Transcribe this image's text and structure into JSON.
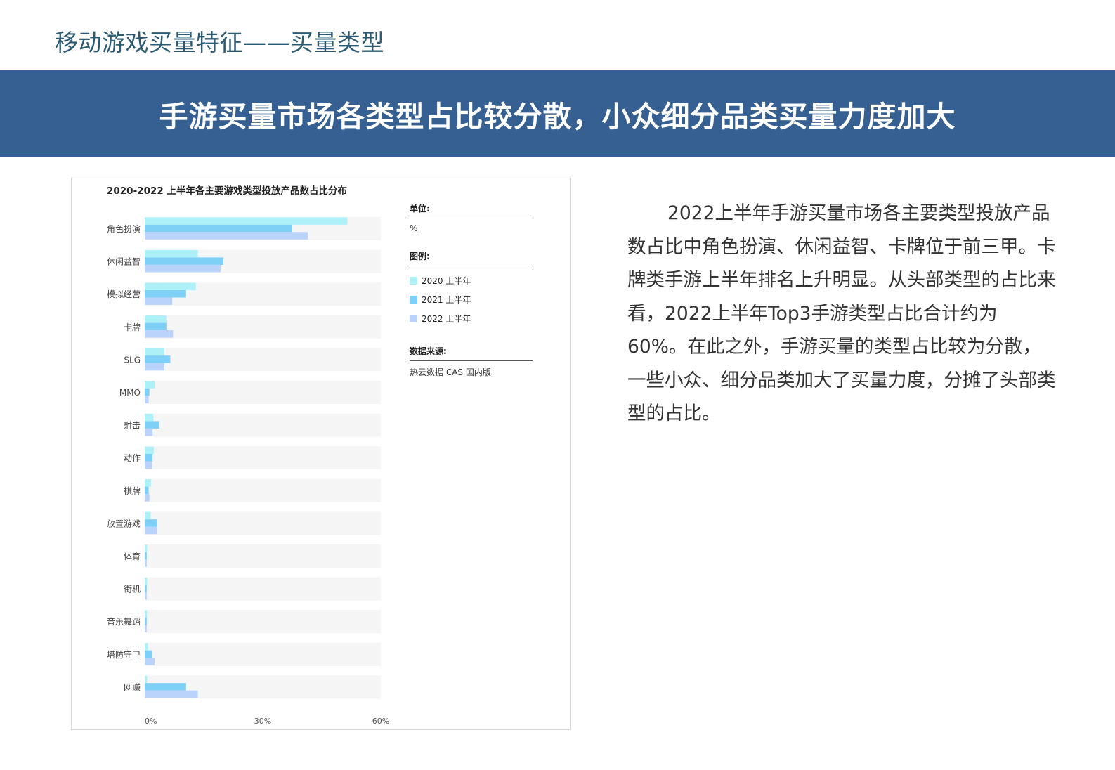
{
  "page": {
    "section_title": "移动游戏买量特征——买量类型",
    "headline": "手游买量市场各类型占比较分散，小众细分品类买量力度加大",
    "body": "2022上半年手游买量市场各主要类型投放产品数占比中角色扮演、休闲益智、卡牌位于前三甲。卡牌类手游上半年排名上升明显。从头部类型的占比来看，2022上半年Top3手游类型占比合计约为60%。在此之外，手游买量的类型占比较为分散，一些小众、细分品类加大了买量力度，分摊了头部类型的占比。"
  },
  "legend_panel": {
    "unit_heading": "单位:",
    "unit_value": "%",
    "legend_heading": "图例:",
    "source_heading": "数据来源:",
    "source_value": "热云数据 CAS 国内版"
  },
  "chart_data": {
    "type": "bar",
    "orientation": "horizontal",
    "title": "2020-2022 上半年各主要游戏类型投放产品数占比分布",
    "categories": [
      "角色扮演",
      "休闲益智",
      "模拟经营",
      "卡牌",
      "SLG",
      "MMO",
      "射击",
      "动作",
      "棋牌",
      "放置游戏",
      "体育",
      "街机",
      "音乐舞蹈",
      "塔防守卫",
      "网赚"
    ],
    "series": [
      {
        "name": "2020 上半年",
        "color": "#aef0f8",
        "values": [
          51.5,
          13.5,
          13,
          5.5,
          5,
          2.5,
          2.2,
          2.3,
          1.6,
          1.5,
          0.6,
          0.6,
          0.6,
          0.8,
          0.6
        ]
      },
      {
        "name": "2021 上半年",
        "color": "#7fd0f6",
        "values": [
          37.5,
          20,
          10.5,
          5.5,
          6.5,
          1.2,
          3.7,
          2,
          1,
          3.2,
          0.5,
          0.5,
          0.5,
          1.8,
          10.5
        ]
      },
      {
        "name": "2022 上半年",
        "color": "#b9d3fb",
        "values": [
          41.5,
          19.3,
          7,
          7.2,
          5,
          1,
          2,
          1.8,
          1.2,
          3.1,
          0.5,
          0.5,
          0.5,
          2.5,
          13.5
        ]
      }
    ],
    "xlim": [
      0,
      60
    ],
    "x_ticks": [
      0,
      30,
      60
    ],
    "x_tick_labels": [
      "0%",
      "30%",
      "60%"
    ],
    "grid": false,
    "legend_position": "right"
  }
}
